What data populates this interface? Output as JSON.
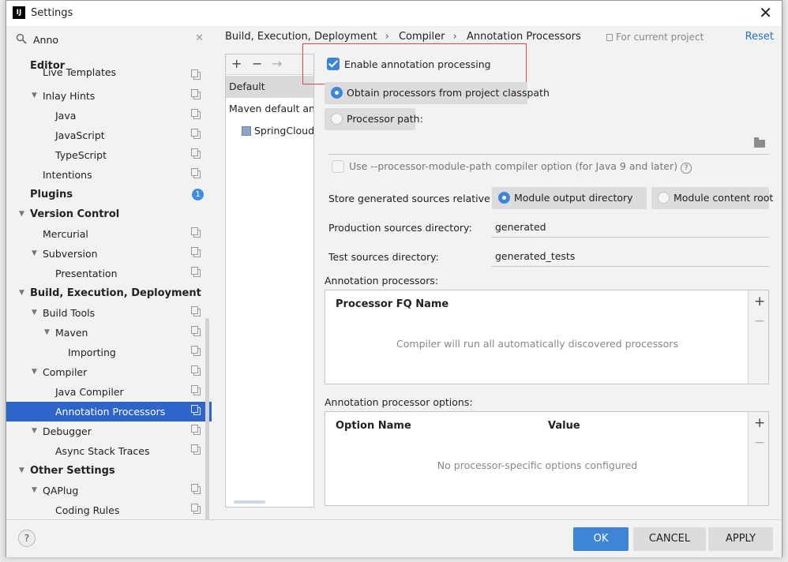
{
  "window": {
    "title": "Settings",
    "app_icon": "IJ"
  },
  "search": {
    "value": "Anno"
  },
  "sidebar": {
    "items": [
      {
        "label": "Editor",
        "level": 0,
        "bold": true
      },
      {
        "label": "Live Templates",
        "level": 1
      },
      {
        "label": "Inlay Hints",
        "level": 1,
        "expanded": true
      },
      {
        "label": "Java",
        "level": 2
      },
      {
        "label": "JavaScript",
        "level": 2
      },
      {
        "label": "TypeScript",
        "level": 2
      },
      {
        "label": "Intentions",
        "level": 1
      },
      {
        "label": "Plugins",
        "level": 0,
        "bold": true,
        "badge": "1"
      },
      {
        "label": "Version Control",
        "level": 0,
        "bold": true,
        "expanded": true
      },
      {
        "label": "Mercurial",
        "level": 1
      },
      {
        "label": "Subversion",
        "level": 1,
        "expanded": true
      },
      {
        "label": "Presentation",
        "level": 2
      },
      {
        "label": "Build, Execution, Deployment",
        "level": 0,
        "bold": true,
        "expanded": true
      },
      {
        "label": "Build Tools",
        "level": 1,
        "expanded": true
      },
      {
        "label": "Maven",
        "level": 2,
        "expanded": true
      },
      {
        "label": "Importing",
        "level": 3
      },
      {
        "label": "Compiler",
        "level": 1,
        "expanded": true
      },
      {
        "label": "Java Compiler",
        "level": 2
      },
      {
        "label": "Annotation Processors",
        "level": 2,
        "selected": true
      },
      {
        "label": "Debugger",
        "level": 1,
        "expanded": true
      },
      {
        "label": "Async Stack Traces",
        "level": 2
      },
      {
        "label": "Other Settings",
        "level": 0,
        "bold": true,
        "expanded": true
      },
      {
        "label": "QAPlug",
        "level": 1,
        "expanded": true
      },
      {
        "label": "Coding Rules",
        "level": 2
      }
    ]
  },
  "breadcrumb": {
    "items": [
      "Build, Execution, Deployment",
      "Compiler",
      "Annotation Processors"
    ],
    "separator": "›"
  },
  "header": {
    "for_project": "For current project",
    "reset": "Reset"
  },
  "profiles": {
    "toolbar": {
      "add": "+",
      "remove": "−",
      "move": "→"
    },
    "items": [
      "Default",
      "Maven default annotation processors profile",
      "SpringCloudDemo"
    ]
  },
  "options": {
    "enable_processing": "Enable annotation processing",
    "obtain_classpath": "Obtain processors from project classpath",
    "processor_path": "Processor path:",
    "module_path": "Use --processor-module-path compiler option (for Java 9 and later)",
    "store_relative": "Store generated sources relative to:",
    "module_output": "Module output directory",
    "module_content": "Module content root",
    "production_label": "Production sources directory:",
    "production_value": "generated",
    "test_label": "Test sources directory:",
    "test_value": "generated_tests",
    "processors_label": "Annotation processors:",
    "processors_col": "Processor FQ Name",
    "processors_empty": "Compiler will run all automatically discovered processors",
    "options_label": "Annotation processor options:",
    "options_col1": "Option Name",
    "options_col2": "Value",
    "options_empty": "No processor-specific options configured",
    "add_sign": "+",
    "remove_sign": "−"
  },
  "footer": {
    "help": "?",
    "ok": "OK",
    "cancel": "CANCEL",
    "apply": "APPLY"
  }
}
